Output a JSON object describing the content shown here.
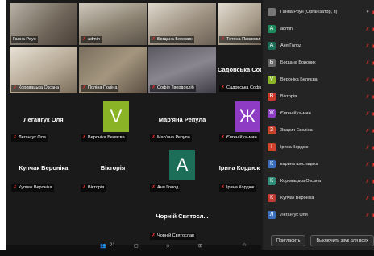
{
  "tiles_video": [
    {
      "name": "Ганна Роун",
      "muted": false
    },
    {
      "name": "admin",
      "muted": true
    },
    {
      "name": "Богдана Боровик",
      "muted": true
    },
    {
      "name": "Тетяна Павлович",
      "muted": true
    },
    {
      "name": "Коровацька Оксана",
      "muted": true
    },
    {
      "name": "Поліна Поліна",
      "muted": true
    },
    {
      "name": "Софія Твердохліб",
      "muted": true
    }
  ],
  "sadovska_big": "Садовська Софія",
  "sadovska_small": "Садовська Софія",
  "tiles_avatar": [
    {
      "big": "Легангук Оля",
      "small": "Легангук Оля"
    },
    {
      "big": "",
      "small": "Вероніка Беляєва",
      "letter": "V",
      "color": "#8bb326"
    },
    {
      "big": "Мар'яна Репула",
      "small": "Мар'яна Репула"
    },
    {
      "big": "",
      "small": "Євген Кузьмин",
      "letter": "Ж",
      "color": "#8e3cc4"
    },
    {
      "big": "Купчак Вероніка",
      "small": "Купчак Вероніка"
    },
    {
      "big": "Вікторія",
      "small": "Вікторія"
    },
    {
      "big": "",
      "small": "Аня Голод",
      "letter": "A",
      "color": "#1c6e58"
    },
    {
      "big": "Ірина Кордюк",
      "small": "Ірина Кордюк"
    },
    {
      "big": "Чорній Святосл...",
      "small": "Чорній Святослав"
    }
  ],
  "participants": [
    {
      "name": "Ганна Роун (Організатор, я)",
      "letter": "",
      "color": "#777777",
      "mic": "on"
    },
    {
      "name": "admin",
      "letter": "A",
      "color": "#1c8a5a",
      "mic": "off"
    },
    {
      "name": "Аня Голод",
      "letter": "A",
      "color": "#1c6e58",
      "mic": "off"
    },
    {
      "name": "Богдана Боровик",
      "letter": "Б",
      "color": "#6a6a6a",
      "mic": "off"
    },
    {
      "name": "Вероніка Беляєва",
      "letter": "V",
      "color": "#8bb326",
      "mic": "off"
    },
    {
      "name": "Вікторія",
      "letter": "B",
      "color": "#c93b2b",
      "mic": "off"
    },
    {
      "name": "Євген Кузьмин",
      "letter": "Ж",
      "color": "#8e3cc4",
      "mic": "off"
    },
    {
      "name": "Зварич Евеліна",
      "letter": "З",
      "color": "#c6432d",
      "mic": "off"
    },
    {
      "name": "Ірина Кордюк",
      "letter": "I",
      "color": "#d0432f",
      "mic": "off"
    },
    {
      "name": "карина шостацька",
      "letter": "К",
      "color": "#3a6fbf",
      "mic": "off"
    },
    {
      "name": "Коровацька Оксана",
      "letter": "К",
      "color": "#2f8f7a",
      "mic": "off"
    },
    {
      "name": "Купчак Вероніка",
      "letter": "К",
      "color": "#c13a2f",
      "mic": "off"
    },
    {
      "name": "Легангук Оля",
      "letter": "Л",
      "color": "#3b6fc0",
      "mic": "off"
    }
  ],
  "buttons": {
    "invite": "Пригласить",
    "mute_all": "Выключить звук для всех",
    "more": "..."
  },
  "toolbar": {
    "count": "21"
  }
}
